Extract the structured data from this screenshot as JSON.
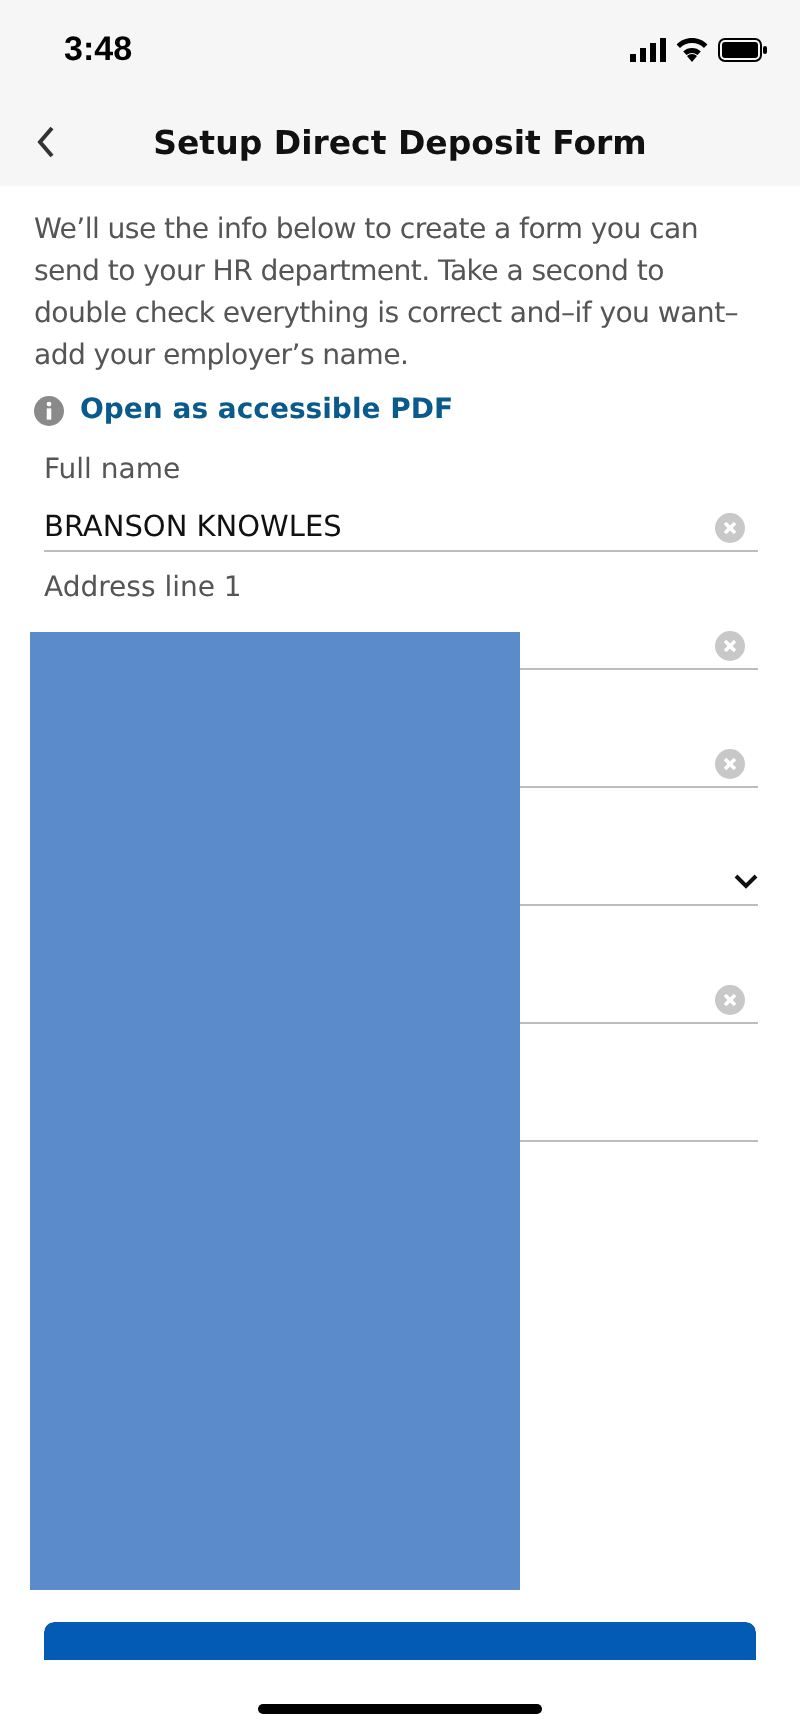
{
  "status_bar": {
    "time": "3:48"
  },
  "nav_bar": {
    "title": "Setup Direct Deposit Form"
  },
  "intro": "We’ll use the info below to create a form you can send to your HR department. Take a second to double check everything is correct and–if you want–add your employer’s name.",
  "pdf_link": "Open as accessible PDF",
  "fields": [
    {
      "kind": "text",
      "label": "Full name",
      "value": "BRANSON KNOWLES",
      "clearable": true
    },
    {
      "kind": "text",
      "label": "Address line 1",
      "clearable": true
    },
    {
      "kind": "text",
      "clearable": true
    },
    {
      "kind": "select"
    },
    {
      "kind": "text",
      "clearable": true
    },
    {
      "kind": "text",
      "clearable": false
    }
  ],
  "redaction": {
    "kind": "block"
  },
  "primary_button": {
    "kind": "cut"
  }
}
